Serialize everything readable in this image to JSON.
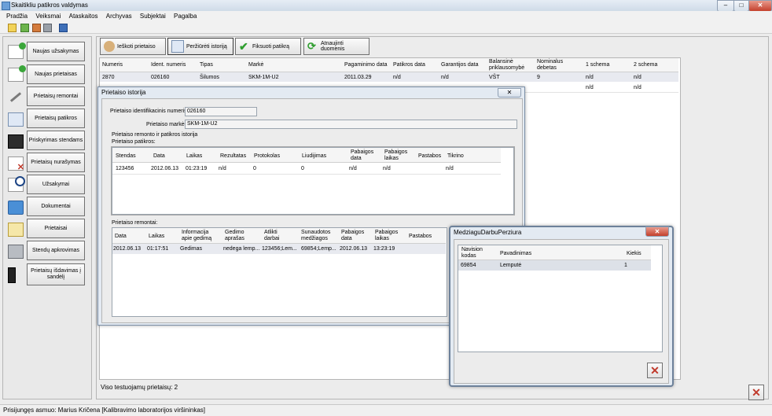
{
  "window": {
    "title": "Skaitikliu patikros valdymas"
  },
  "menu": [
    "Pradžia",
    "Veiksmai",
    "Ataskaitos",
    "Archyvas",
    "Subjektai",
    "Pagalba"
  ],
  "sidebar": {
    "items": [
      {
        "label": "Naujas užsakymas",
        "icon": "new-order-icon"
      },
      {
        "label": "Naujas prietaisas",
        "icon": "new-device-icon"
      },
      {
        "label": "Prietaisų remontai",
        "icon": "wrench-icon"
      },
      {
        "label": "Prietaisų patikros",
        "icon": "inspection-icon"
      },
      {
        "label": "Priskyrimas stendams",
        "icon": "stand-icon"
      },
      {
        "label": "Prietaisų nurašymas",
        "icon": "write-off-icon"
      },
      {
        "label": "Užsakymai",
        "icon": "orders-icon"
      },
      {
        "label": "Dokumentai",
        "icon": "folder-icon"
      },
      {
        "label": "Prietaisai",
        "icon": "devices-icon"
      },
      {
        "label": "Stendų apkrovimas",
        "icon": "printer-icon"
      },
      {
        "label": "Prietaisų išdavimas į sandėlį",
        "icon": "warehouse-icon"
      }
    ]
  },
  "toolbar": {
    "search_label": "Ieškoti prietaiso",
    "history_label": "Peržiūrėti istoriją",
    "record_label": "Fiksuoti patikrą",
    "refresh_label": "Atnaujinti duomenis"
  },
  "grid": {
    "columns": [
      "Numeris",
      "Ident. numeris",
      "Tipas",
      "Markė",
      "Pagaminimo data",
      "Patikros data",
      "Garantijos data",
      "Balansinė priklausomybė",
      "Nominalus debetas",
      "1 schema",
      "2 schema"
    ],
    "rows": [
      [
        "2870",
        "026160",
        "Šilumos",
        "SKM-1M-U2",
        "2011.03.29",
        "n/d",
        "n/d",
        "VŠT",
        "9",
        "n/d",
        "n/d"
      ],
      [
        "",
        "",
        "",
        "",
        "",
        "",
        "",
        "",
        "",
        "n/d",
        "n/d"
      ]
    ],
    "footer": "Viso testuojamų prietaisų: 2"
  },
  "history": {
    "title": "Prietaiso istorija",
    "ident_label": "Prietaiso identifikacinis numeris:",
    "ident_value": "026160",
    "marke_label": "Prietaiso markė:",
    "marke_value": "SKM-1M-U2",
    "group_label": "Prietaiso remonto ir patikros istorija",
    "inspections_label": "Prietaiso patikros:",
    "inspections_columns": [
      "Stendas",
      "Data",
      "Laikas",
      "Rezultatas",
      "Protokolas",
      "Liudijimas",
      "Pabaigos data",
      "Pabaigos laikas",
      "Pastabos",
      "Tikrino"
    ],
    "inspections_rows": [
      [
        "123456",
        "2012.06.13",
        "01:23:19",
        "n/d",
        "0",
        "0",
        "n/d",
        "n/d",
        "",
        "n/d"
      ]
    ],
    "repairs_label": "Prietaiso remontai:",
    "repairs_columns": [
      "Data",
      "Laikas",
      "Informacija apie gedimą",
      "Gedimo aprašas",
      "Atlikti darbai",
      "Sunaudotos medžiagos",
      "Pabaigos data",
      "Pabaigos laikas",
      "Pastabos"
    ],
    "repairs_rows": [
      [
        "2012.06.13",
        "01:17:51",
        "Gedimas",
        "nedega lemp...",
        "123456;Lem...",
        "69854;Lemp...",
        "2012.06.13",
        "13:23:19",
        ""
      ]
    ]
  },
  "materials": {
    "title": "MedziaguDarbuPerziura",
    "columns": [
      "Navision kodas",
      "Pavadinimas",
      "Kiekis"
    ],
    "rows": [
      [
        "69854",
        "Lemputė",
        "1"
      ]
    ]
  },
  "status": {
    "user": "Prisijungęs asmuo: Marius Kričena [Kalibravimo laboratorijos viršininkas]"
  },
  "colors": {
    "accent": "#c0392b",
    "selection": "#e8eaf0"
  }
}
